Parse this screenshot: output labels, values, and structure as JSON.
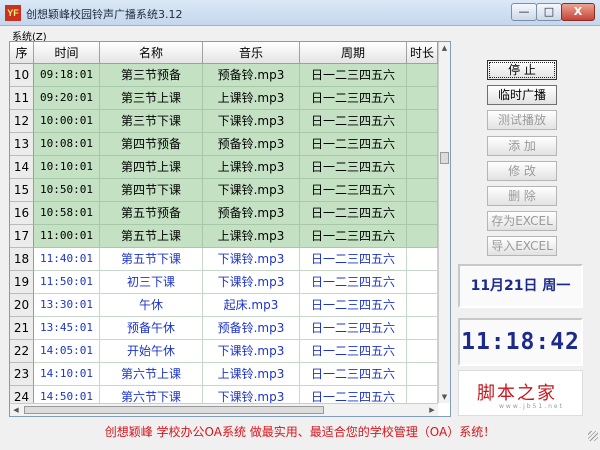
{
  "window": {
    "app_icon": "YF",
    "title": "创想颖峰校园铃声广播系统3.12",
    "minimize": "—",
    "maximize": "□",
    "close": "X"
  },
  "menu": {
    "system": "系统(Z)"
  },
  "table": {
    "headers": [
      "序",
      "时间",
      "名称",
      "音乐",
      "周期",
      "时长"
    ],
    "rows": [
      {
        "seq": "10",
        "time": "09:18:01",
        "name": "第三节预备",
        "music": "预备铃.mp3",
        "cycle": "日一二三四五六",
        "active": true
      },
      {
        "seq": "11",
        "time": "09:20:01",
        "name": "第三节上课",
        "music": "上课铃.mp3",
        "cycle": "日一二三四五六",
        "active": true
      },
      {
        "seq": "12",
        "time": "10:00:01",
        "name": "第三节下课",
        "music": "下课铃.mp3",
        "cycle": "日一二三四五六",
        "active": true
      },
      {
        "seq": "13",
        "time": "10:08:01",
        "name": "第四节预备",
        "music": "预备铃.mp3",
        "cycle": "日一二三四五六",
        "active": true
      },
      {
        "seq": "14",
        "time": "10:10:01",
        "name": "第四节上课",
        "music": "上课铃.mp3",
        "cycle": "日一二三四五六",
        "active": true
      },
      {
        "seq": "15",
        "time": "10:50:01",
        "name": "第四节下课",
        "music": "下课铃.mp3",
        "cycle": "日一二三四五六",
        "active": true
      },
      {
        "seq": "16",
        "time": "10:58:01",
        "name": "第五节预备",
        "music": "预备铃.mp3",
        "cycle": "日一二三四五六",
        "active": true
      },
      {
        "seq": "17",
        "time": "11:00:01",
        "name": "第五节上课",
        "music": "上课铃.mp3",
        "cycle": "日一二三四五六",
        "active": true
      },
      {
        "seq": "18",
        "time": "11:40:01",
        "name": "第五节下课",
        "music": "下课铃.mp3",
        "cycle": "日一二三四五六",
        "active": false
      },
      {
        "seq": "19",
        "time": "11:50:01",
        "name": "初三下课",
        "music": "下课铃.mp3",
        "cycle": "日一二三四五六",
        "active": false
      },
      {
        "seq": "20",
        "time": "13:30:01",
        "name": "午休",
        "music": "起床.mp3",
        "cycle": "日一二三四五六",
        "active": false
      },
      {
        "seq": "21",
        "time": "13:45:01",
        "name": "预备午休",
        "music": "预备铃.mp3",
        "cycle": "日一二三四五六",
        "active": false
      },
      {
        "seq": "22",
        "time": "14:05:01",
        "name": "开始午休",
        "music": "下课铃.mp3",
        "cycle": "日一二三四五六",
        "active": false
      },
      {
        "seq": "23",
        "time": "14:10:01",
        "name": "第六节上课",
        "music": "上课铃.mp3",
        "cycle": "日一二三四五六",
        "active": false
      },
      {
        "seq": "24",
        "time": "14:50:01",
        "name": "第六节下课",
        "music": "下课铃.mp3",
        "cycle": "日一二三四五六",
        "active": false
      }
    ]
  },
  "buttons": [
    {
      "label": "停  止",
      "enabled": true,
      "primary": true
    },
    {
      "label": "临时广播",
      "enabled": true,
      "primary": false
    },
    {
      "label": "测试播放",
      "enabled": false,
      "primary": false
    },
    {
      "label": "添  加",
      "enabled": false,
      "primary": false
    },
    {
      "label": "修  改",
      "enabled": false,
      "primary": false
    },
    {
      "label": "删  除",
      "enabled": false,
      "primary": false
    },
    {
      "label": "存为EXCEL",
      "enabled": false,
      "primary": false
    },
    {
      "label": "导入EXCEL",
      "enabled": false,
      "primary": false
    }
  ],
  "date_display": "11月21日  周一",
  "clock_display": "11:18:42",
  "logo": {
    "text": "脚本之家",
    "url": "www.jb51.net"
  },
  "status_text": "创想颖峰  学校办公OA系统  做最实用、最适合您的学校管理（OA）系统！",
  "colors": {
    "active_row": "#c4e1c4",
    "inactive_text": "#1c34c8",
    "status_text": "#d8141c",
    "clock_text": "#1c2a8c"
  }
}
